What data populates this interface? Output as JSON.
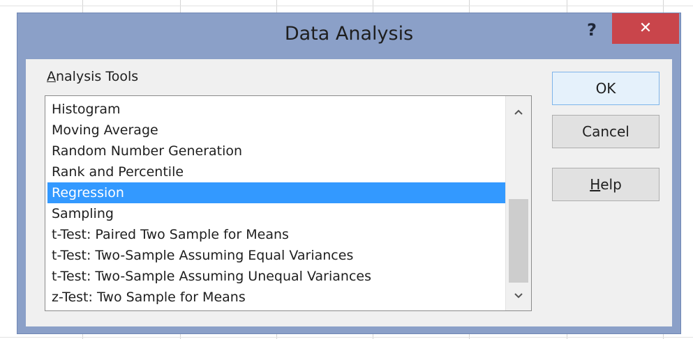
{
  "dialog": {
    "title": "Data Analysis",
    "help_glyph": "?",
    "close_glyph": "✕",
    "group_label_accel": "A",
    "group_label_rest": "nalysis Tools",
    "items": [
      "Histogram",
      "Moving Average",
      "Random Number Generation",
      "Rank and Percentile",
      "Regression",
      "Sampling",
      "t-Test: Paired Two Sample for Means",
      "t-Test: Two-Sample Assuming Equal Variances",
      "t-Test: Two-Sample Assuming Unequal Variances",
      "z-Test: Two Sample for Means"
    ],
    "selected": "Regression",
    "scroll_up_glyph": "⌃",
    "scroll_down_glyph": "⌄",
    "buttons": {
      "ok": "OK",
      "cancel": "Cancel",
      "help_accel": "H",
      "help_rest": "elp"
    }
  },
  "colors": {
    "frame": "#8ba0c8",
    "close": "#c9454b",
    "selection": "#3399ff"
  },
  "icons": {
    "help": "question-mark-icon",
    "close": "close-icon",
    "scroll_up": "chevron-up-icon",
    "scroll_down": "chevron-down-icon"
  }
}
